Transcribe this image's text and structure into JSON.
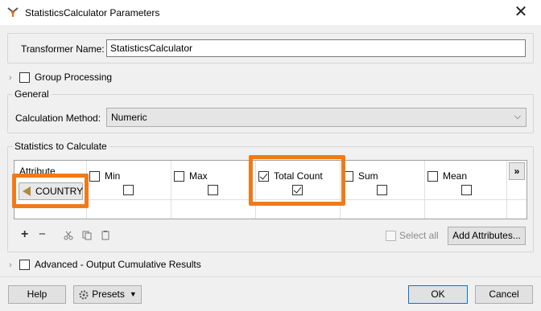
{
  "window": {
    "title": "StatisticsCalculator Parameters",
    "close_glyph": "✕"
  },
  "transformer": {
    "label": "Transformer Name:",
    "value": "StatisticsCalculator"
  },
  "group_processing": {
    "label": "Group Processing",
    "checked": false
  },
  "general": {
    "title": "General",
    "calc_method_label": "Calculation Method:",
    "calc_method_value": "Numeric",
    "dropdown_icon": "chevron-down-icon"
  },
  "stats": {
    "title": "Statistics to Calculate",
    "columns": [
      {
        "label": "Attribute",
        "checkbox": false
      },
      {
        "label": "Min",
        "checkbox": true,
        "header_checked": false,
        "cell_checked": false
      },
      {
        "label": "Max",
        "checkbox": true,
        "header_checked": false,
        "cell_checked": false
      },
      {
        "label": "Total Count",
        "checkbox": true,
        "header_checked": true,
        "cell_checked": true
      },
      {
        "label": "Sum",
        "checkbox": true,
        "header_checked": false,
        "cell_checked": false
      },
      {
        "label": "Mean",
        "checkbox": true,
        "header_checked": false,
        "cell_checked": false
      }
    ],
    "rows": [
      {
        "attribute": "COUNTRY"
      }
    ],
    "scroll_right": "»",
    "highlight_color": "#f07a1a"
  },
  "toolbar": {
    "add": "+",
    "remove": "−",
    "cut_icon": "scissors-icon",
    "copy_icon": "copy-icon",
    "paste_icon": "clipboard-icon",
    "select_all_label": "Select all",
    "add_attributes_label": "Add Attributes..."
  },
  "advanced": {
    "label": "Advanced - Output Cumulative Results",
    "checked": false
  },
  "footer": {
    "help_label": "Help",
    "presets_label": "Presets",
    "ok_label": "OK",
    "cancel_label": "Cancel"
  }
}
